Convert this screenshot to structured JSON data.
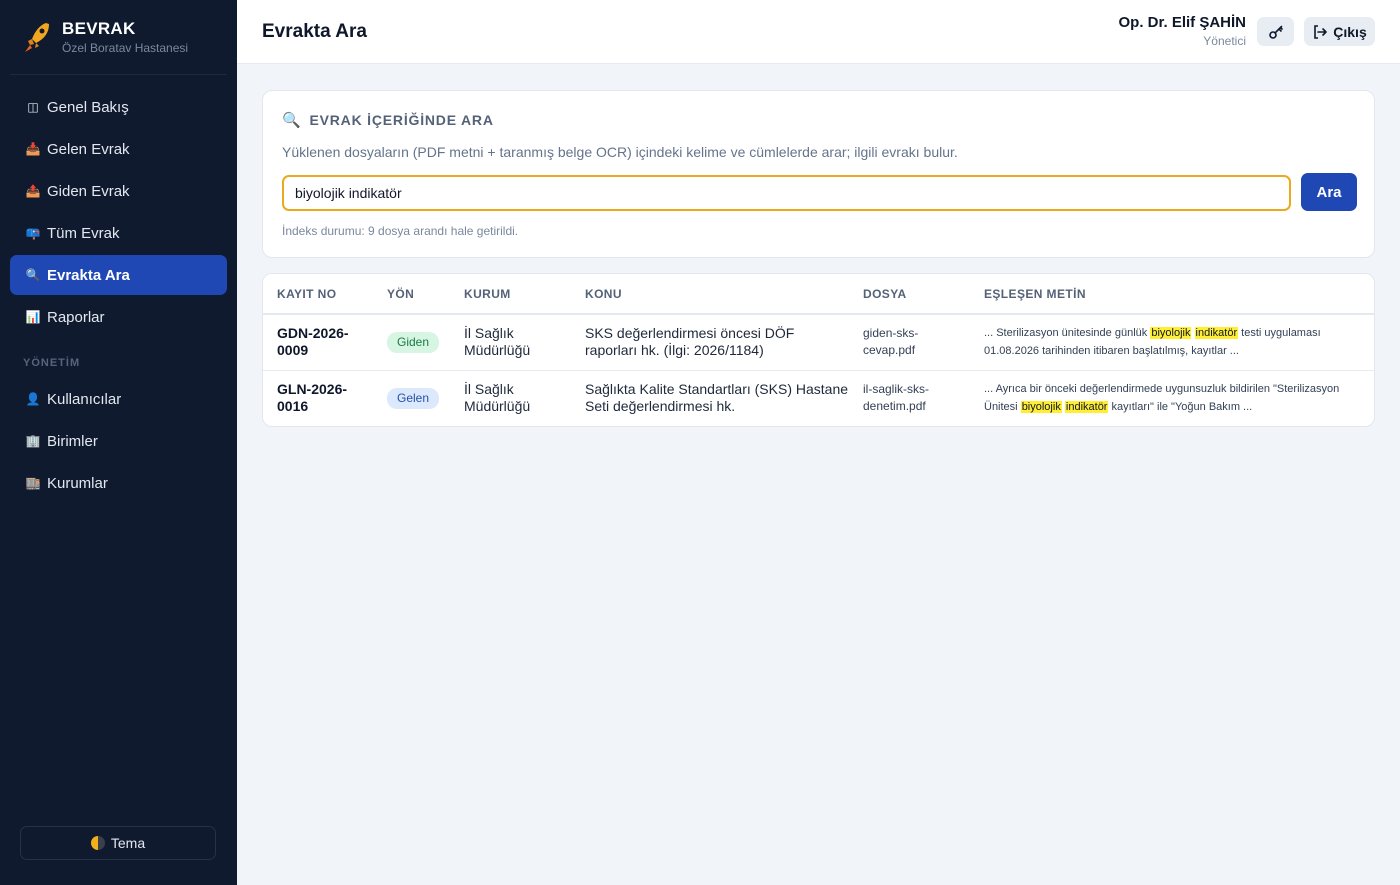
{
  "brand": {
    "name": "BEVRAK",
    "subtitle": "Özel Boratav Hastanesi"
  },
  "sidebar": {
    "items": [
      {
        "label": "Genel Bakış",
        "icon": "layout-icon",
        "glyph": "◫"
      },
      {
        "label": "Gelen Evrak",
        "icon": "inbox-tray-icon",
        "glyph": "📥"
      },
      {
        "label": "Giden Evrak",
        "icon": "outbox-tray-icon",
        "glyph": "📤"
      },
      {
        "label": "Tüm Evrak",
        "icon": "mailbox-icon",
        "glyph": "📪"
      },
      {
        "label": "Evrakta Ara",
        "icon": "magnifier-icon",
        "glyph": "🔍",
        "active": true
      },
      {
        "label": "Raporlar",
        "icon": "bar-chart-icon",
        "glyph": "📊"
      }
    ],
    "section_label": "YÖNETİM",
    "admin_items": [
      {
        "label": "Kullanıcılar",
        "icon": "user-icon",
        "glyph": "👤"
      },
      {
        "label": "Birimler",
        "icon": "building-icon",
        "glyph": "🏢"
      },
      {
        "label": "Kurumlar",
        "icon": "office-icon",
        "glyph": "🏬"
      }
    ],
    "theme_label": "Tema"
  },
  "header": {
    "title": "Evrakta Ara",
    "user_name": "Op. Dr. Elif ŞAHİN",
    "user_role": "Yönetici",
    "logout_label": "Çıkış"
  },
  "search": {
    "title": "EVRAK İÇERİĞİNDE ARA",
    "description": "Yüklenen dosyaların (PDF metni + taranmış belge OCR) içindeki kelime ve cümlelerde arar; ilgili evrakı bulur.",
    "query": "biyolojik indikatör",
    "button_label": "Ara",
    "index_status": "İndeks durumu: 9 dosya arandı hale getirildi."
  },
  "results": {
    "columns": [
      "KAYIT NO",
      "YÖN",
      "KURUM",
      "KONU",
      "DOSYA",
      "EŞLEŞEN METİN"
    ],
    "rows": [
      {
        "reg_no": "GDN-2026-0009",
        "direction": "Giden",
        "institution": "İl Sağlık Müdürlüğü",
        "subject": "SKS değerlendirmesi öncesi DÖF raporları hk. (İlgi: 2026/1184)",
        "file": "giden-sks-cevap.pdf",
        "match_before": "... Sterilizasyon ünitesinde günlük ",
        "match_hl1": "biyolojik",
        "match_hl2": "indikatör",
        "match_after": " testi uygulaması 01.08.2026 tarihinden itibaren başlatılmış, kayıtlar ..."
      },
      {
        "reg_no": "GLN-2026-0016",
        "direction": "Gelen",
        "institution": "İl Sağlık Müdürlüğü",
        "subject": "Sağlıkta Kalite Standartları (SKS) Hastane Seti değerlendirmesi hk.",
        "file": "il-saglik-sks-denetim.pdf",
        "match_before": "... Ayrıca bir önceki değerlendirmede uygunsuzluk bildirilen \"Sterilizasyon Ünitesi ",
        "match_hl1": "biyolojik",
        "match_hl2": "indikatör",
        "match_after": " kayıtları\" ile \"Yoğun Bakım ..."
      }
    ]
  },
  "colors": {
    "sidebar_bg": "#0f1a2e",
    "accent": "#1f48b5",
    "input_focus": "#eaa91e",
    "highlight": "#ffee32"
  }
}
